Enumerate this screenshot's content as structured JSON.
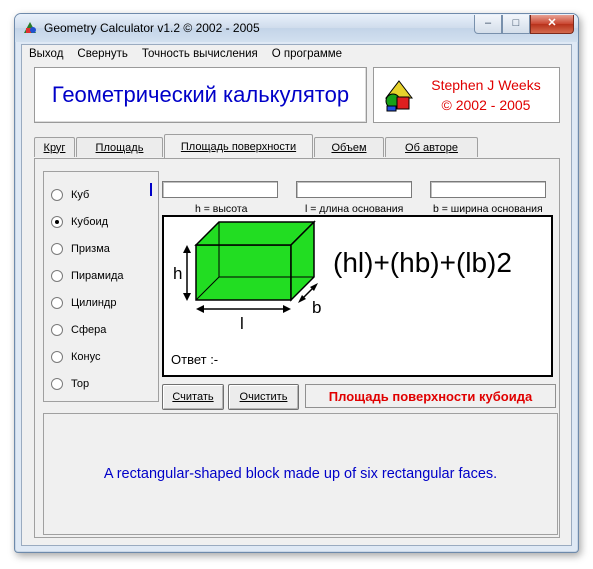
{
  "window": {
    "title": "Geometry Calculator v1.2 ©  2002 - 2005"
  },
  "title_buttons": {
    "minimize": "–",
    "maximize": "□",
    "close": "✕"
  },
  "menu": [
    "Выход",
    "Свернуть",
    "Точность вычисления",
    "О программе"
  ],
  "banner": {
    "title": "Геометрический калькулятор",
    "author": "Stephen J Weeks",
    "years": "© 2002 - 2005"
  },
  "tabs": [
    "Круг",
    "Площадь",
    "Площадь поверхности",
    "Объем",
    "Об авторе"
  ],
  "active_tab": "Площадь поверхности",
  "shapes": [
    {
      "label": "Куб",
      "checked": false
    },
    {
      "label": "Кубоид",
      "checked": true
    },
    {
      "label": "Призма",
      "checked": false
    },
    {
      "label": "Пирамида",
      "checked": false
    },
    {
      "label": "Цилиндр",
      "checked": false
    },
    {
      "label": "Сфера",
      "checked": false
    },
    {
      "label": "Конус",
      "checked": false
    },
    {
      "label": "Тор",
      "checked": false
    }
  ],
  "inputs": [
    {
      "label": "h = высота",
      "value": ""
    },
    {
      "label": "l = длина основания",
      "value": ""
    },
    {
      "label": "b = ширина основания",
      "value": ""
    }
  ],
  "drawing": {
    "formula": "(hl)+(hb)+(lb)2",
    "dim_h": "h",
    "dim_l": "l",
    "dim_b": "b",
    "answer_label": "Ответ :-",
    "fill_color": "#22dd22"
  },
  "buttons": {
    "calculate": "Считать",
    "clear": "Очистить"
  },
  "result_title": "Площадь поверхности кубоида",
  "description": "A rectangular-shaped block made up of six rectangular faces.",
  "colors": {
    "blue_text": "#0000c8",
    "red_text": "#e00000"
  }
}
